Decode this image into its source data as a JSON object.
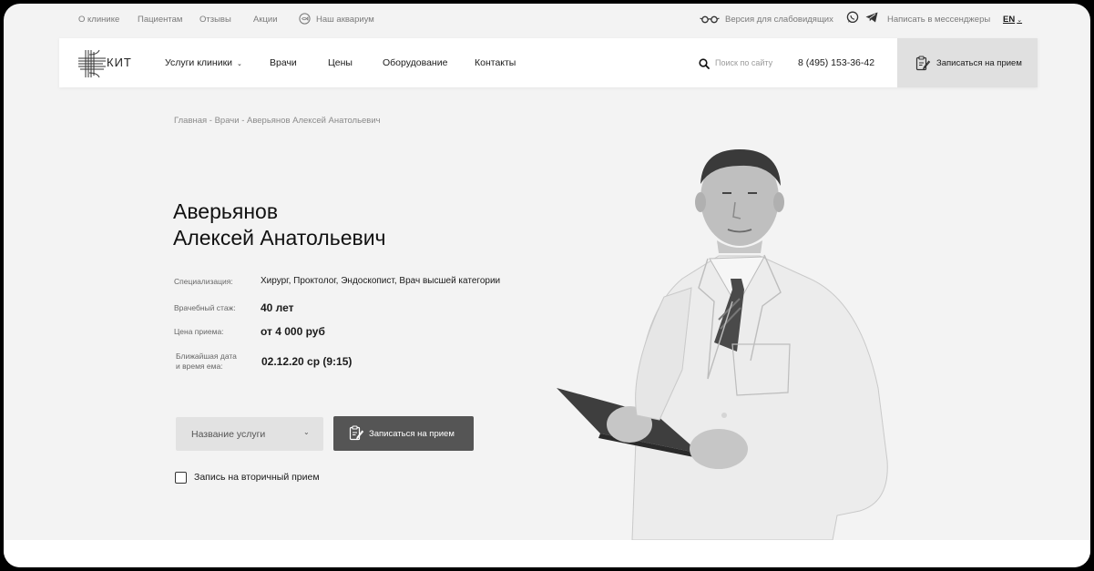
{
  "topbar": {
    "links": [
      "О клинике",
      "Пациентам",
      "Отзывы",
      "Акции"
    ],
    "aquarium": "Наш аквариум",
    "low_vision": "Версия для слабовидящих",
    "messengers": "Написать в мессенджеры",
    "lang": "EN"
  },
  "header": {
    "logo_text": "КИТ",
    "nav": [
      "Услуги клиники",
      "Врачи",
      "Цены",
      "Оборудование",
      "Контакты"
    ],
    "search_placeholder": "Поиск по сайту",
    "phone": "8 (495) 153-36-42",
    "appointment_button": "Записаться на прием"
  },
  "breadcrumb": "Главная - Врачи - Аверьянов Алексей Анатольевич",
  "doctor": {
    "surname": "Аверьянов",
    "name": "Алексей Анатольевич",
    "specialization_label": "Специализация:",
    "specialization": "Хирург, Проктолог, Эндоскопист, Врач высшей категории",
    "experience_label": "Врачебный стаж:",
    "experience": "40 лет",
    "price_label": "Цена приема:",
    "price": "от 4 000 руб",
    "nearest_label_1": "Ближайшая дата",
    "nearest_label_2": "и время ема:",
    "nearest": "02.12.20 ср  (9:15)"
  },
  "booking": {
    "service_select": "Название услуги",
    "submit": "Записаться на прием",
    "secondary_checkbox": "Запись на вторичный прием"
  },
  "icons": {
    "aquarium": "fish-icon",
    "low_vision": "glasses-icon",
    "whatsapp": "whatsapp-icon",
    "telegram": "telegram-icon",
    "search": "search-icon",
    "appointment": "clipboard-pen-icon",
    "select": "chevron-down-icon"
  },
  "colors": {
    "background": "#f3f3f3",
    "cta": "#555555",
    "header_button": "#e0e0e0",
    "select": "#e2e2e2"
  }
}
